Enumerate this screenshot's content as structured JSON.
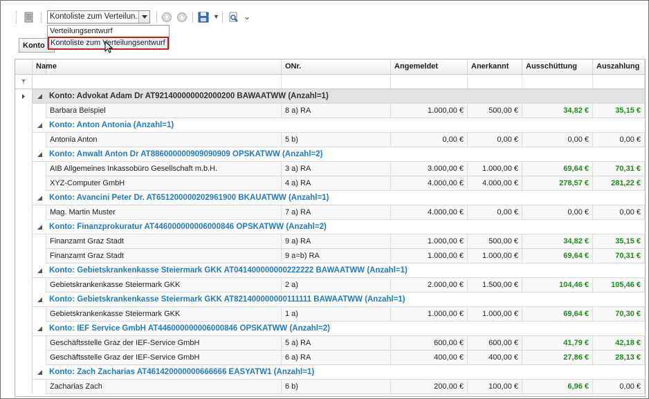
{
  "toolbar": {
    "combo_value": "Kontoliste zum Verteilun...",
    "dropdown_items": [
      "Verteilungsentwurf",
      "Kontoliste zum Verteilungsentwurf"
    ]
  },
  "group_panel": {
    "chip_label": "Konto"
  },
  "grid": {
    "columns": [
      "Name",
      "ONr.",
      "Angemeldet",
      "Anerkannt",
      "Ausschüttung",
      "Auszahlung"
    ],
    "groups": [
      {
        "label": "Konto: Advokat Adam Dr AT921400000002000200 BAWAATWW (Anzahl=1)",
        "rows": [
          [
            "Barbara Beispiel",
            "8 a) RA",
            "1.000,00 €",
            "500,00 €",
            "34,82 €",
            "35,15 €"
          ]
        ]
      },
      {
        "label": "Konto: Anton Antonia   (Anzahl=1)",
        "rows": [
          [
            "Antonia Anton",
            "5 b)",
            "0,00 €",
            "0,00 €",
            "0,00 €",
            "0,00 €"
          ]
        ]
      },
      {
        "label": "Konto: Anwalt Anton Dr AT886000000909090909 OPSKATWW (Anzahl=2)",
        "rows": [
          [
            "AIB Allgemeines Inkassobüro Gesellschaft m.b.H.",
            "3 a) RA",
            "3.000,00 €",
            "1.000,00 €",
            "69,64 €",
            "70,31 €"
          ],
          [
            "XYZ-Computer GmbH",
            "4 a) RA",
            "4.000,00 €",
            "4.000,00 €",
            "278,57 €",
            "281,22 €"
          ]
        ]
      },
      {
        "label": "Konto: Avancini Peter Dr. AT651200000202961900 BKAUATWW (Anzahl=1)",
        "rows": [
          [
            "Mag. Martin Muster",
            "7 a) RA",
            "4.000,00 €",
            "0,00 €",
            "0,00 €",
            "0,00 €"
          ]
        ]
      },
      {
        "label": "Konto: Finanzprokuratur AT446000000006000846 OPSKATWW (Anzahl=2)",
        "rows": [
          [
            "Finanzamt Graz Stadt",
            "9 a) RA",
            "1.000,00 €",
            "500,00 €",
            "34,82 €",
            "35,15 €"
          ],
          [
            "Finanzamt Graz Stadt",
            "9 a=b) RA",
            "1.000,00 €",
            "1.000,00 €",
            "69,64 €",
            "70,31 €"
          ]
        ]
      },
      {
        "label": "Konto: Gebietskrankenkasse Steiermark GKK AT041400000000222222 BAWAATWW (Anzahl=1)",
        "rows": [
          [
            "Gebietskrankenkasse Steiermark GKK",
            "2 a)",
            "2.000,00 €",
            "1.500,00 €",
            "104,46 €",
            "105,46 €"
          ]
        ]
      },
      {
        "label": "Konto: Gebietskrankenkasse Steiermark GKK AT821400000000111111 BAWAATWW (Anzahl=1)",
        "rows": [
          [
            "Gebietskrankenkasse Steiermark GKK",
            "1 a)",
            "1.000,00 €",
            "1.000,00 €",
            "69,64 €",
            "70,30 €"
          ]
        ]
      },
      {
        "label": "Konto: IEF Service GmbH AT446000000006000846 OPSKATWW (Anzahl=2)",
        "rows": [
          [
            "Geschäftsstelle Graz der IEF-Service GmbH",
            "5 a) RA",
            "600,00 €",
            "600,00 €",
            "41,79 €",
            "42,18 €"
          ],
          [
            "Geschäftsstelle Graz der IEF-Service GmbH",
            "6 a) RA",
            "400,00 €",
            "400,00 €",
            "27,86 €",
            "28,13 €"
          ]
        ]
      },
      {
        "label": "Konto: Zach Zacharias AT461420000000666666 EASYATW1 (Anzahl=1)",
        "rows": [
          [
            "Zacharias Zach",
            "6 b)",
            "200,00 €",
            "100,00 €",
            "6,96 €",
            "0,00 €"
          ]
        ]
      }
    ]
  }
}
